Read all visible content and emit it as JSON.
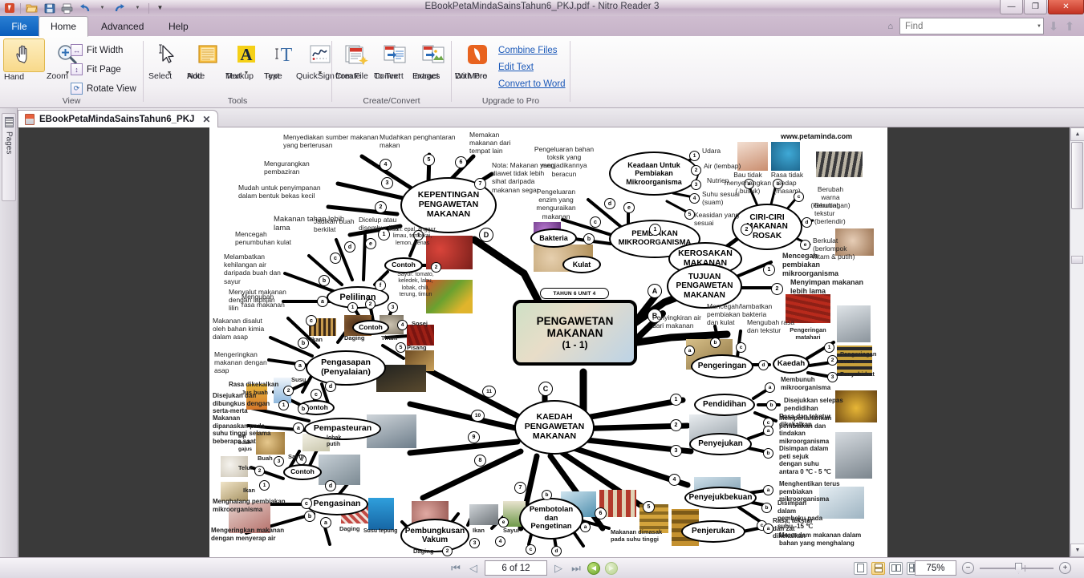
{
  "window": {
    "title": "EBookPetaMindaSainsTahun6_PKJ.pdf - Nitro Reader 3",
    "minimize": "—",
    "maximize": "❐",
    "close": "✕"
  },
  "quick_access": {
    "items": [
      "open-icon",
      "save-icon",
      "print-icon",
      "undo-icon",
      "redo-icon",
      "customize-icon"
    ]
  },
  "ribbon": {
    "tabs": [
      {
        "id": "file",
        "label": "File"
      },
      {
        "id": "home",
        "label": "Home"
      },
      {
        "id": "advanced",
        "label": "Advanced"
      },
      {
        "id": "help",
        "label": "Help"
      }
    ],
    "groups": [
      {
        "id": "view",
        "label": "View"
      },
      {
        "id": "tools",
        "label": "Tools"
      },
      {
        "id": "create_convert",
        "label": "Create/Convert"
      },
      {
        "id": "upgrade",
        "label": "Upgrade to Pro"
      }
    ],
    "view": {
      "hand": "Hand",
      "zoom": "Zoom",
      "fit_width": "Fit Width",
      "fit_page": "Fit Page",
      "rotate_view": "Rotate View"
    },
    "tools": {
      "select": "Select",
      "add_note_1": "Add",
      "add_note_2": "Note",
      "markup_1": "Markup",
      "markup_2": "Text",
      "type_1": "Type",
      "type_2": "Text",
      "quicksign": "QuickSign"
    },
    "create_convert": {
      "create_1": "Create",
      "create_2": "from File",
      "convert_1": "Convert",
      "convert_2": "To Text",
      "extract_1": "Extract",
      "extract_2": "Images"
    },
    "upgrade": {
      "do_more_1": "Do More",
      "do_more_2": "With Pro",
      "links": [
        "Combine Files",
        "Edit Text",
        "Convert to Word"
      ]
    }
  },
  "find": {
    "placeholder": "Find",
    "search_icon": "search-icon",
    "home_icon": "home-icon"
  },
  "doc_tab": {
    "label": "EBookPetaMindaSainsTahun6_PKJ",
    "close": "✕"
  },
  "pages_rail": {
    "label": "Pages"
  },
  "status": {
    "page_value": "6 of 12",
    "zoom_value": "75%",
    "first": "first-page",
    "prev": "prev-page",
    "next": "next-page",
    "last": "last-page"
  },
  "mindmap": {
    "watermark": "www.petaminda.com",
    "center": {
      "badge": "TAHUN 6  UNIT 4",
      "line1": "PENGAWETAN",
      "line2": "MAKANAN",
      "line3": "(1 - 1)"
    },
    "nodes": {
      "kepentingan": "KEPENTINGAN PENGAWETAN MAKANAN",
      "pembiakan": "PEMBIAKAN MIKROORGANISMA",
      "keadaan": "Keadaan Untuk Pembiakan Mikroorganisma",
      "ciriciri": "CIRI-CIRI MAKANAN ROSAK",
      "kerosakan": "KEROSAKAN MAKANAN",
      "tujuan": "TUJUAN PENGAWETAN MAKANAN",
      "kaedah_hub": "KAEDAH PENGAWETAN MAKANAN",
      "bakteria": "Bakteria",
      "kulat": "Kulat",
      "pengeringan": "Pengeringan",
      "kaedah_small": "Kaedah",
      "pendidihan": "Pendidihan",
      "penyejukan": "Penyejukan",
      "penyejukbekuan": "Penyejukbekuan",
      "penjerukan": "Penjerukan",
      "pembotolan": "Pembotolan dan Pengetinan",
      "pembungkusan": "Pembungkusan Vakum",
      "pengasinan": "Pengasinan",
      "pempasteuran": "Pempasteuran",
      "pengasapan": "Pengasapan (Penyalaian)",
      "pelilinan": "Pelilinan",
      "contoh": "Contoh"
    },
    "kepentingan_items": [
      {
        "n": "1",
        "t": "Makanan tahan lebih lama"
      },
      {
        "n": "2",
        "t": "Mudah untuk penyimpanan dalam bentuk bekas kecil"
      },
      {
        "n": "3",
        "t": "Mengurangkan pembaziran"
      },
      {
        "n": "4",
        "t": "Menyediakan sumber makanan yang berterusan"
      },
      {
        "n": "5",
        "t": "Mudahkan penghantaran makan"
      },
      {
        "n": "6",
        "t": "Memakan makanan dari tempat lain"
      },
      {
        "n": "7",
        "t": "Nota: Makanan yang diawet tidak lebih sihat daripada makanan segar"
      }
    ],
    "pembiakan_items": [
      {
        "n": "b",
        "t": "Bakteria"
      },
      {
        "n": "c",
        "t": "Pengeluaran enzim yang menguraikan makanan"
      },
      {
        "n": "d",
        "t": "Pengeluaran bahan toksik yang menjadikannya beracun"
      }
    ],
    "keadaan_items": [
      {
        "n": "1",
        "t": "Udara"
      },
      {
        "n": "2",
        "t": "Air (lembap)"
      },
      {
        "n": "3",
        "t": "Nutrien"
      },
      {
        "n": "4",
        "t": "Suhu sesuai (suam)"
      },
      {
        "n": "5",
        "t": "Keasidan yang sesuai"
      }
    ],
    "ciriciri_items": [
      {
        "n": "a",
        "t": "Bau tidak menyenangkan ( busuk)"
      },
      {
        "n": "b",
        "t": "Rasa tidak sedap (masam)"
      },
      {
        "n": "c",
        "t": "Berubah warna (kekuningan)"
      },
      {
        "n": "d",
        "t": "Berubah tekstur (berlendir)"
      },
      {
        "n": "e",
        "t": "Berkulat (berlompok hitam & putih)"
      }
    ],
    "tujuan_items": [
      {
        "n": "1",
        "t": "Mencegah pembiakan mikroorganisma"
      },
      {
        "n": "2",
        "t": "Menyimpan makanan lebih lama"
      }
    ],
    "pengeringan_items": [
      {
        "n": "a",
        "t": "Penyingkiran air dari makanan"
      },
      {
        "n": "b",
        "t": "Mencegah/lambatkan pembiakan bakteria dan kulat"
      },
      {
        "n": "c",
        "t": "Mengubah rasa dan tekstur"
      },
      {
        "n": "d",
        "t": "Kaedah"
      }
    ],
    "kaedah_small_items": [
      {
        "n": "1",
        "t": "Pengeringan matahari"
      },
      {
        "n": "2",
        "t": "Pengeringan oven"
      },
      {
        "n": "3",
        "t": "Penyahidrat"
      }
    ],
    "pendidihan_items": [
      {
        "n": "a",
        "t": "Membunuh mikroorganisma"
      },
      {
        "n": "b",
        "t": "Disejukkan selepas pendidihan"
      },
      {
        "n": "c",
        "t": "Rasa dan tekstur dikekalkan"
      }
    ],
    "penyejukan_items": [
      {
        "n": "a",
        "t": "Memperlahankan pembiakan dan tindakan mikroorganisma"
      },
      {
        "n": "b",
        "t": "Disimpan dalam peti sejuk dengan suhu antara 0 ℃ -  5 ℃"
      }
    ],
    "penyejukbekuan_items": [
      {
        "n": "a",
        "t": "Menghentikan terus pembiakan mikroorganisma"
      },
      {
        "n": "b",
        "t": "Disimpan dalam pembeku pada suhu -15 ℃"
      },
      {
        "n": "c",
        "t": "Rasa, tekstur dan zat dikekalkan"
      }
    ],
    "penjerukan_items": [
      {
        "n": "a",
        "t": "Merendam makanan dalam bahan yang menghalang"
      }
    ],
    "pembotolan_items": [
      {
        "n": "a",
        "t": "Makanan dimasak pada suhu tinggi"
      }
    ],
    "pelilinan_items": [
      {
        "n": "a",
        "t": "Menyalut makanan dengan lapisan lilin"
      },
      {
        "n": "b",
        "t": "Melambatkan kehilangan air daripada buah dan sayur"
      },
      {
        "n": "c",
        "t": "Mencegah penumbuhan kulat"
      },
      {
        "n": "d",
        "t": "Jadikan buah berkilat"
      },
      {
        "n": "e",
        "t": "Dicelup atau disembur lilin"
      },
      {
        "n": "f",
        "t": "Contoh"
      }
    ],
    "pelilinan_contoh": [
      {
        "n": "1",
        "t": "Buah: epal,  anggur, limau,  tembikai, lemon,   nenas"
      },
      {
        "n": "2",
        "t": "Sayur: tomato, keledek, labu,  lobak, chili,  terung, timun"
      }
    ],
    "pengasapan_items": [
      {
        "n": "a",
        "t": "Mengeringkan makanan dengan asap"
      },
      {
        "n": "b",
        "t": "Makanan disalut oleh bahan kimia dalam asap"
      },
      {
        "n": "c",
        "t": "Mengubah rasa makanan"
      }
    ],
    "pengasapan_contoh": [
      {
        "n": "1",
        "t": "Ikan"
      },
      {
        "n": "2",
        "t": "Daging"
      },
      {
        "n": "3",
        "t": "Tiram"
      },
      {
        "n": "4",
        "t": "Sosej"
      },
      {
        "n": "5",
        "t": "Pisang"
      }
    ],
    "pempasteuran_items": [
      {
        "n": "a",
        "t": "Makanan dipanaskan pada suhu tinggi selama beberapa saat"
      },
      {
        "n": "b",
        "t": "Disejukan dan dibungkus dengan serta-merta"
      },
      {
        "n": "c",
        "t": "Rasa dikekalkan"
      }
    ],
    "pempasteuran_contoh": [
      {
        "n": "1",
        "t": "Jus buah"
      },
      {
        "n": "2",
        "t": "Susu"
      }
    ],
    "pengasinan_items": [
      {
        "n": "a",
        "t": "Daging"
      },
      {
        "n": "b",
        "t": "Mengeringkan makanan dengan menyerap air"
      },
      {
        "n": "c",
        "t": "Menghalang pembiakan mikroorganisma"
      },
      {
        "n": "d",
        "t": "Contoh"
      }
    ],
    "pengasinan_contoh": [
      {
        "n": "1",
        "t": "Ikan"
      },
      {
        "n": "2",
        "t": "Telur"
      },
      {
        "n": "3",
        "t": "Buah"
      },
      {
        "n": "4",
        "t": "Sayur"
      }
    ],
    "pembungkusan_examples": [
      "Daging",
      "Ikan",
      "Sayur"
    ],
    "branch_letters": [
      "A",
      "B",
      "C",
      "D"
    ],
    "spoke_numbers": [
      "1",
      "2",
      "3",
      "4",
      "5",
      "6",
      "7",
      "8",
      "9",
      "10",
      "11"
    ],
    "extra_labels": {
      "susu_tepung": "Susu tepung",
      "lobak_putih": "lobak putih",
      "biji_buah_gajus": "biji buah gajus",
      "pengeringan_matahari": "Pengeringan matahari",
      "pengeringan_oven": "Pengeringan oven",
      "penyahidrat": "Penyahidrat"
    }
  }
}
